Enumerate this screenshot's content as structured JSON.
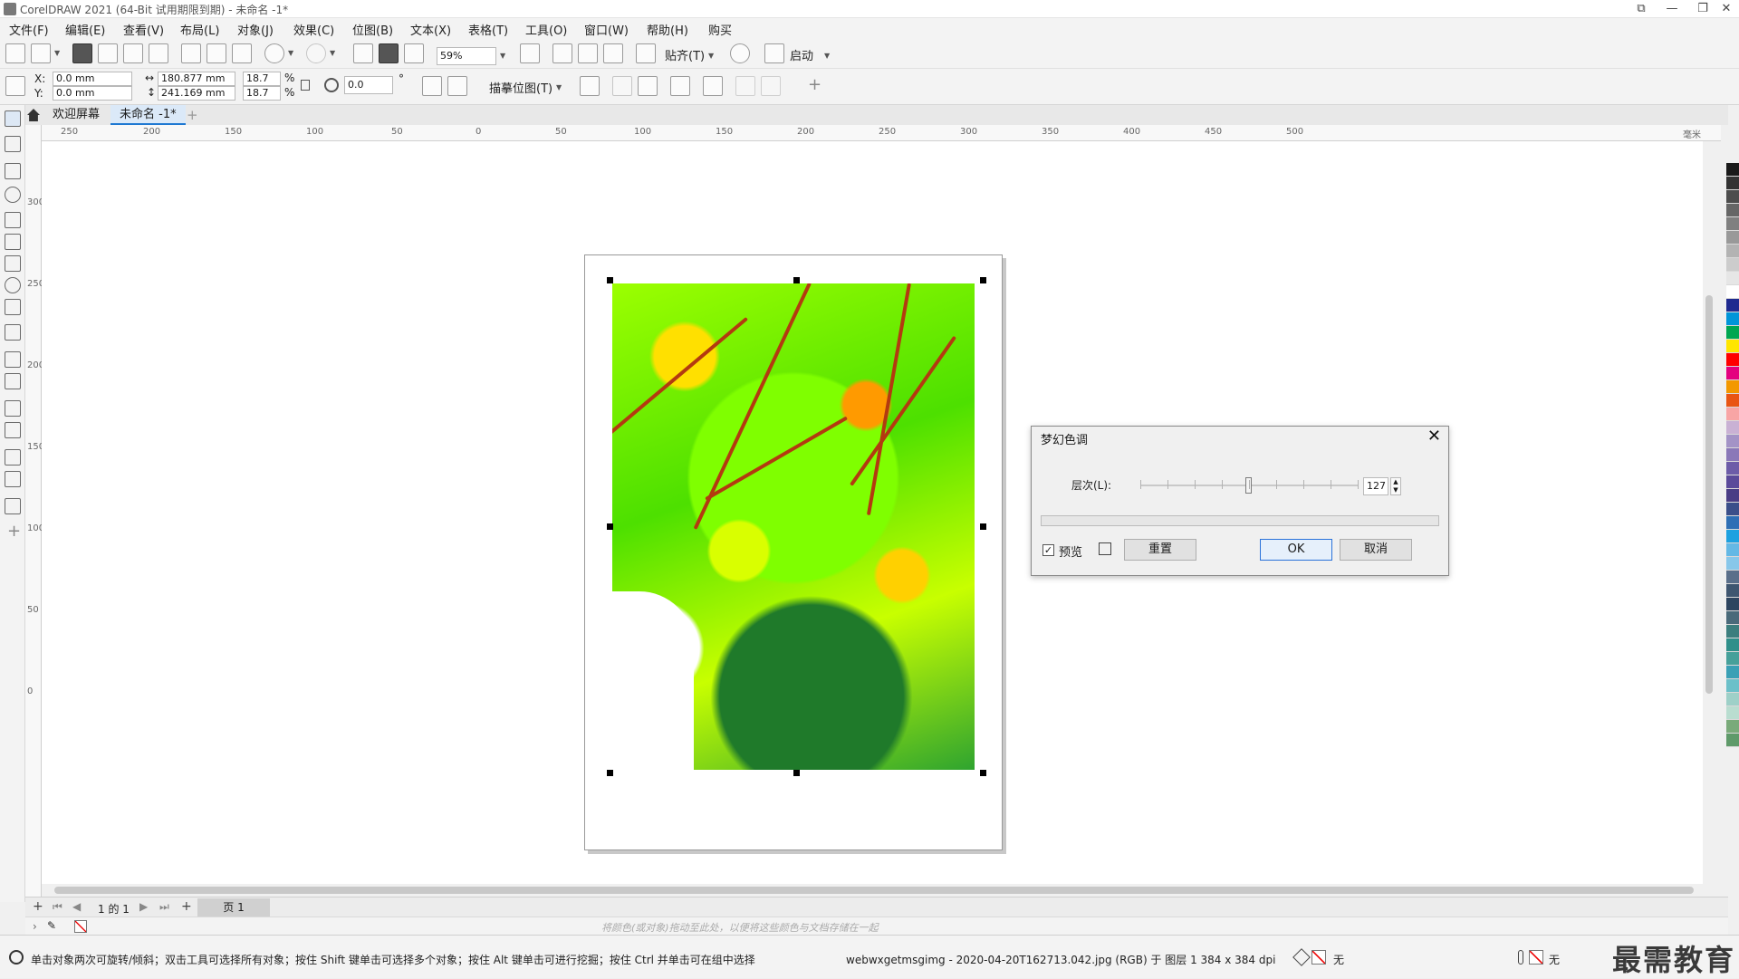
{
  "window": {
    "title": "CorelDRAW 2021 (64-Bit 试用期限到期) - 未命名 -1*"
  },
  "menu": [
    "文件(F)",
    "编辑(E)",
    "查看(V)",
    "布局(L)",
    "对象(J)",
    "效果(C)",
    "位图(B)",
    "文本(X)",
    "表格(T)",
    "工具(O)",
    "窗口(W)",
    "帮助(H)",
    "购买"
  ],
  "toolbar": {
    "zoom": "59%",
    "snap_label": "贴齐(T)",
    "launch_label": "启动",
    "trace_label": "描摹位图(T)"
  },
  "props": {
    "x_label": "X:",
    "x_value": "0.0 mm",
    "y_label": "Y:",
    "y_value": "0.0 mm",
    "w_value": "180.877 mm",
    "h_value": "241.169 mm",
    "scale_x": "18.7",
    "scale_y": "18.7",
    "percent": "%",
    "rotation": "0.0",
    "degree": "°"
  },
  "tabs": {
    "welcome": "欢迎屏幕",
    "doc": "未命名 -1*",
    "add": "+"
  },
  "hruler_labels": [
    "250",
    "200",
    "150",
    "100",
    "50",
    "0",
    "50",
    "100",
    "150",
    "200",
    "250",
    "300",
    "350",
    "400",
    "450",
    "500",
    "毫米"
  ],
  "vruler_labels": [
    "300",
    "250",
    "200",
    "150",
    "100",
    "50",
    "0"
  ],
  "dialog": {
    "title": "梦幻色调",
    "level_label": "层次(L):",
    "level_value": "127",
    "level_fraction": 0.5,
    "preview_label": "预览",
    "reset_label": "重置",
    "ok_label": "OK",
    "cancel_label": "取消"
  },
  "pagenav": {
    "page_of": "1 的 1",
    "page_tab": "页 1"
  },
  "colorbar_hint": "将颜色(或对象)拖动至此处，以便将这些颜色与文档存储在一起",
  "status": {
    "hint": "单击对象两次可旋转/倾斜；双击工具可选择所有对象；按住 Shift 键单击可选择多个对象；按住 Alt 键单击可进行挖掘；按住 Ctrl 并单击可在组中选择",
    "file_info": "webwxgetmsgimg - 2020-04-20T162713.042.jpg (RGB) 于 图层 1 384 x 384 dpi",
    "fill_none": "无",
    "outline_none": "无"
  },
  "watermark": "最需教育",
  "palette_colors": [
    "#1a1a1a",
    "#333333",
    "#4d4d4d",
    "#666666",
    "#808080",
    "#999999",
    "#b3b3b3",
    "#cccccc",
    "#e6e6e6",
    "#ffffff",
    "#1f2a8f",
    "#0095d9",
    "#00a651",
    "#ffe600",
    "#ff0000",
    "#e4007f",
    "#f39800",
    "#e95513",
    "#f8a5a5",
    "#c9b1d4",
    "#a393c6",
    "#8a78b8",
    "#6d5ca8",
    "#5b4a9a",
    "#4a3d85",
    "#3b4f8a",
    "#2e6fb5",
    "#1da1e0",
    "#64b8e5",
    "#88c7ea",
    "#5a6f8a",
    "#3f5670",
    "#2e4560",
    "#4a6a7a",
    "#3c7e7e",
    "#2f8f8a",
    "#46a09a",
    "#3aa0b5",
    "#6cc0c9",
    "#9ed0c8",
    "#b9ddd0",
    "#7aaa7a",
    "#5f9a6a"
  ]
}
